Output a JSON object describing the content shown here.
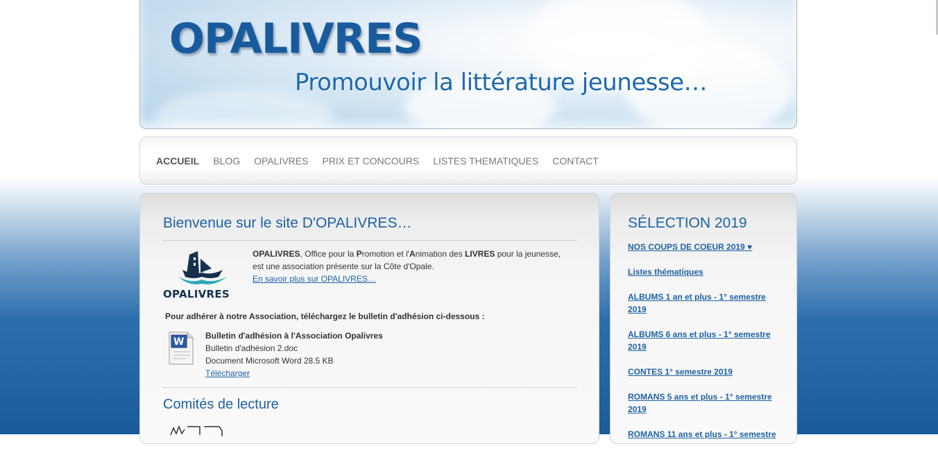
{
  "header": {
    "title": "OPALIVRES",
    "tagline": "Promouvoir la littérature jeunesse…"
  },
  "nav": {
    "items": [
      {
        "label": "ACCUEIL",
        "active": true
      },
      {
        "label": "BLOG"
      },
      {
        "label": "OPALIVRES"
      },
      {
        "label": "PRIX ET CONCOURS"
      },
      {
        "label": "LISTES THEMATIQUES"
      },
      {
        "label": "CONTACT"
      }
    ]
  },
  "main": {
    "title": "Bienvenue sur le site D'OPALIVRES…",
    "logo_text": "OPALIVRES",
    "intro": {
      "p1": "OPALIVRES",
      "p2": ", Office pour la ",
      "p3": "P",
      "p4": "romotion et l'",
      "p5": "A",
      "p6": "nimation des ",
      "p7": "LIVRES",
      "p8": " pour la jeunesse,",
      "line2": "est une association présente sur la Côte d'Opale.",
      "link": "En savoir plus sur OPALIVRES…"
    },
    "adhere_text": "Pour adhérer à notre Association, téléchargez le bulletin d'adhésion ci-dessous :",
    "download": {
      "title": "Bulletin d'adhésion à l'Association Opalivres",
      "filename": "Bulletin d'adhésion 2.doc",
      "filetype": "Document Microsoft Word 28.5 KB",
      "link": "Télécharger"
    },
    "subtitle": "Comités de lecture"
  },
  "sidebar": {
    "title": "SÉLECTION 2019",
    "links": [
      "NOS COUPS DE COEUR 2019  ♥",
      "Listes thématiques",
      "ALBUMS  1 an et plus - 1° semestre 2019",
      "ALBUMS 6 ans et plus - 1° semestre 2019",
      "CONTES 1° semestre 2019",
      "ROMANS 5 ans et plus - 1° semestre 2019",
      "ROMANS 11 ans et plus - 1° semestre"
    ]
  },
  "colors": {
    "brand_blue": "#1e62a3",
    "title_blue": "#185a9c",
    "nav_text": "#777777"
  },
  "icons": {
    "logo": "ship-book-logo",
    "document": "word-document-icon"
  }
}
